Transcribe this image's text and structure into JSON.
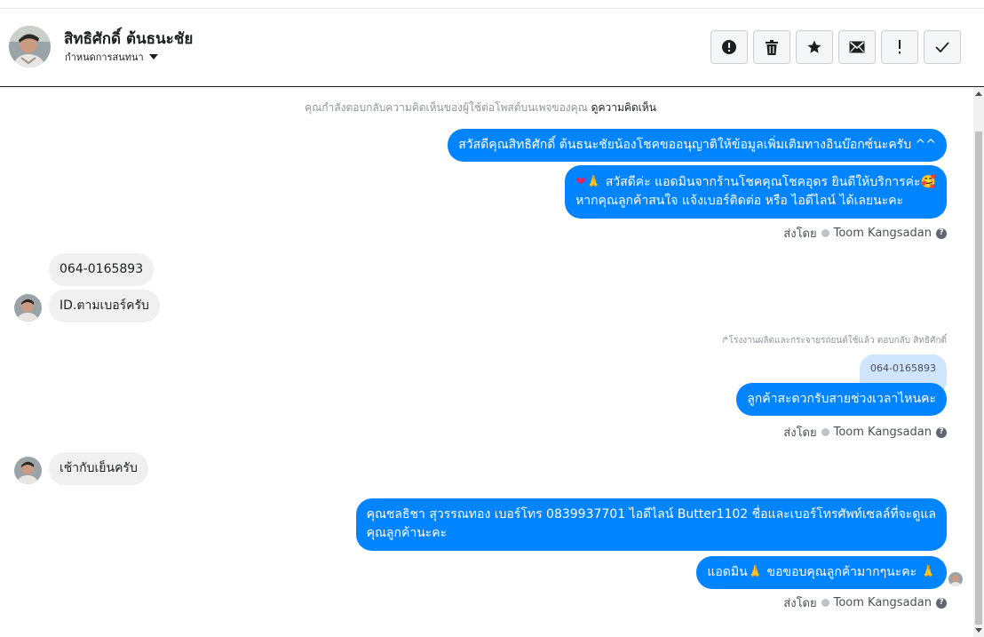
{
  "contact": {
    "name": "สิทธิศักดิ์ ต้นธนะชัย",
    "assign_label": "กำหนดการสนทนา"
  },
  "actions": [
    {
      "icon": "alert-circle-icon",
      "label": "spam"
    },
    {
      "icon": "trash-icon",
      "label": "delete"
    },
    {
      "icon": "star-icon",
      "label": "star"
    },
    {
      "icon": "envelope-icon",
      "label": "mark-unread"
    },
    {
      "icon": "exclamation-icon",
      "label": "follow-up"
    },
    {
      "icon": "check-icon",
      "label": "done"
    }
  ],
  "context": {
    "text": "คุณกำลังตอบกลับความคิดเห็นของผู้ใช้ต่อโพสต์บนเพจของคุณ",
    "link": "ดูความคิดเห็น"
  },
  "messages": {
    "out1": "สวัสดีคุณสิทธิศักดิ์ ต้นธนะชัยน้องโชคขออนุญาติให้ข้อมูลเพิ่มเติมทางอินบ๊อกซ์นะครับ ^^",
    "out2_line1": "สวัสดีค่ะ แอดมินจากร้านโชคคุณโชคอุดร ยินดีให้บริการค่ะ",
    "out2_line2": "หากคุณลูกค้าสนใจ แจ้งเบอร์ติดต่อ หรือ ไอดีไลน์ ได้เลยนะคะ",
    "in1": "064-0165893",
    "in2": "ID.ตามเบอร์ครับ",
    "reply_note": "โรงงานผลิตและกระจายรถยนต์ใช้แล้ว ตอบกลับ สิทธิศักดิ์",
    "quote": "064-0165893",
    "out3": "ลูกค้าสะดวกรับสายช่วงเวลาไหนคะ",
    "in3": "เช้ากับเย็นครับ",
    "out4_line1": "คุณชลธิชา สุวรรณทอง   เบอร์โทร 0839937701  ไอดีไลน์ Butter1102 ชื่อและเบอร์โทรศัพท์เซลล์ที่จะดูแล",
    "out4_line2": "คุณลูกค้านะคะ",
    "out5_pre": "แอดมิน",
    "out5_post": "ขอขอบคุณลูกค้ามากๆนะคะ"
  },
  "sent_by": {
    "prefix": "ส่งโดย",
    "name": "Toom Kangsadan"
  },
  "colors": {
    "outgoing": "#0084ff",
    "incoming": "#f1f0f0",
    "quote": "#cfe4fd"
  }
}
